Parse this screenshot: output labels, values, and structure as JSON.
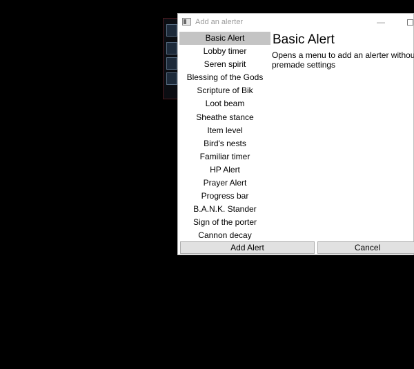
{
  "window": {
    "title": "Add an alerter",
    "minimize_glyph": "—",
    "title_bar_icons": [
      "app-icon",
      "minimize-icon",
      "maximize-icon"
    ]
  },
  "alerter_list": {
    "selected_index": 0,
    "items": [
      "Basic Alert",
      "Lobby timer",
      "Seren spirit",
      "Blessing of the Gods",
      "Scripture of Bik",
      "Loot beam",
      "Sheathe stance",
      "Item level",
      "Bird's nests",
      "Familiar timer",
      "HP Alert",
      "Prayer Alert",
      "Progress bar",
      "B.A.N.K. Stander",
      "Sign of the porter",
      "Cannon decay"
    ]
  },
  "detail": {
    "title": "Basic Alert",
    "description": "Opens a menu to add an alerter without premade settings"
  },
  "buttons": {
    "add_alert": "Add Alert",
    "cancel": "Cancel"
  },
  "colors": {
    "background": "#000000",
    "window": "#ffffff",
    "selection": "#c4c4c4",
    "button_face": "#e1e1e1",
    "title_text": "#9a9a9a"
  }
}
